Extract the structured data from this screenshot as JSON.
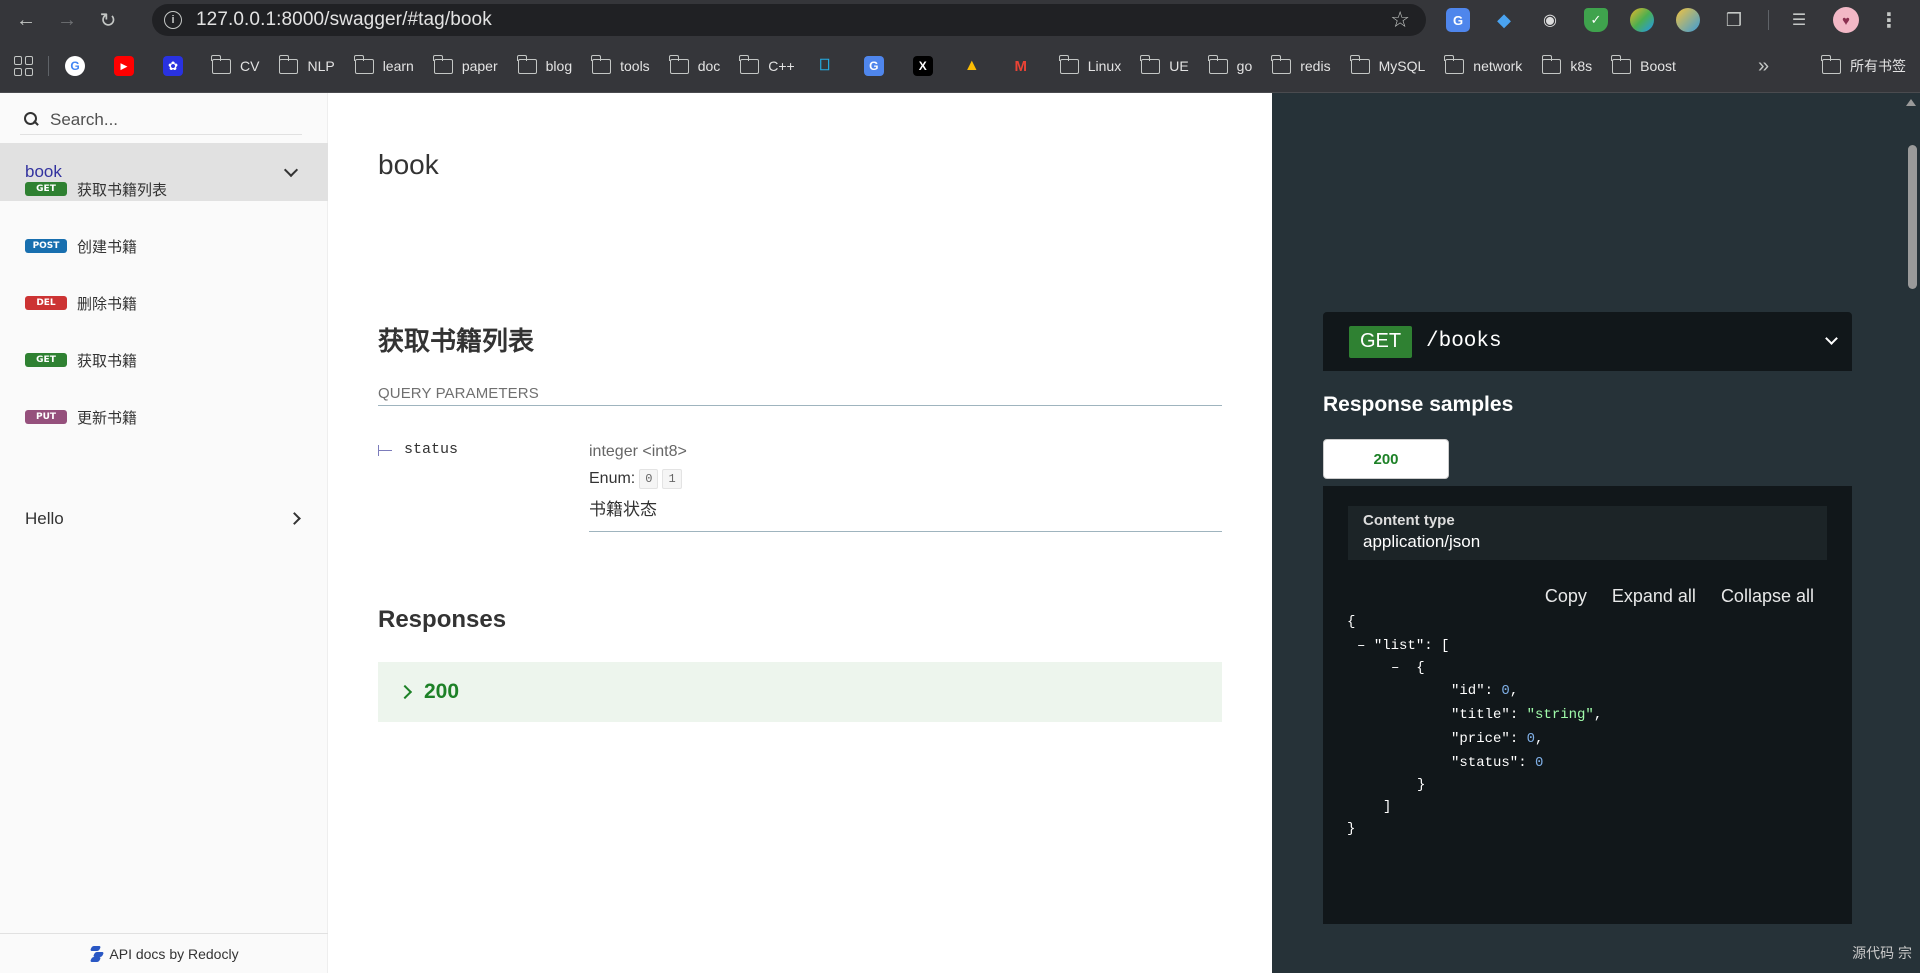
{
  "browser": {
    "url": "127.0.0.1:8000/swagger/#tag/book",
    "bookmarks": [
      "CV",
      "NLP",
      "learn",
      "paper",
      "blog",
      "tools",
      "doc",
      "C++",
      "Linux",
      "UE",
      "go",
      "redis",
      "MySQL",
      "network",
      "k8s",
      "Boost"
    ],
    "all_bookmarks": "所有书签"
  },
  "sidebar": {
    "search_placeholder": "Search...",
    "active_group": "book",
    "operations": [
      {
        "method": "GET",
        "label": "获取书籍列表"
      },
      {
        "method": "POST",
        "label": "创建书籍"
      },
      {
        "method": "DEL",
        "label": "删除书籍"
      },
      {
        "method": "GET",
        "label": "获取书籍"
      },
      {
        "method": "PUT",
        "label": "更新书籍"
      }
    ],
    "other_group": "Hello",
    "footer": "API docs by Redocly"
  },
  "main": {
    "tag_title": "book",
    "operation_title": "获取书籍列表",
    "query_header": "QUERY PARAMETERS",
    "param": {
      "name": "status",
      "type": "integer <int8>",
      "enum_label": "Enum:",
      "enum_values": [
        "0",
        "1"
      ],
      "description": "书籍状态"
    },
    "responses_title": "Responses",
    "response_code": "200"
  },
  "panel": {
    "method": "GET",
    "path": "/books",
    "samples_title": "Response samples",
    "sample_tab": "200",
    "content_type_label": "Content type",
    "content_type": "application/json",
    "tools": [
      "Copy",
      "Expand all",
      "Collapse all"
    ],
    "json": {
      "key_list": "\"list\"",
      "fields": [
        {
          "key": "\"id\"",
          "value": "0",
          "kind": "num",
          "comma": ","
        },
        {
          "key": "\"title\"",
          "value": "\"string\"",
          "kind": "str",
          "comma": ","
        },
        {
          "key": "\"price\"",
          "value": "0",
          "kind": "num",
          "comma": ","
        },
        {
          "key": "\"status\"",
          "value": "0",
          "kind": "num",
          "comma": ""
        }
      ]
    },
    "footer": "源代码  宗"
  },
  "colors": {
    "get": "#2f8132",
    "post": "#186faf",
    "del": "#cc3333",
    "put": "#95507c",
    "active_link": "#32329f"
  }
}
